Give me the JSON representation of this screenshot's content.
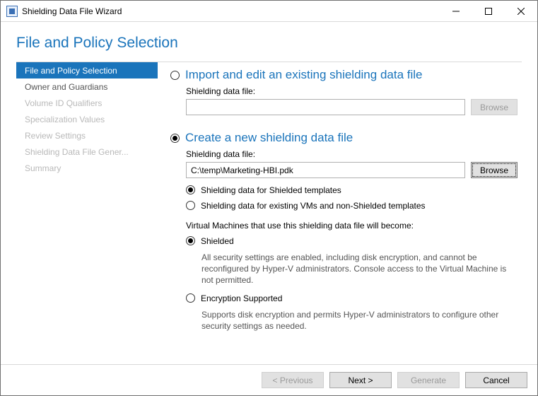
{
  "window": {
    "title": "Shielding Data File Wizard"
  },
  "heading": "File and Policy Selection",
  "sidebar": {
    "items": [
      {
        "label": "File and Policy Selection",
        "active": true,
        "enabled": true
      },
      {
        "label": "Owner and Guardians",
        "active": false,
        "enabled": true
      },
      {
        "label": "Volume ID Qualifiers",
        "active": false,
        "enabled": false
      },
      {
        "label": "Specialization Values",
        "active": false,
        "enabled": false
      },
      {
        "label": "Review Settings",
        "active": false,
        "enabled": false
      },
      {
        "label": "Shielding Data File Gener...",
        "active": false,
        "enabled": false
      },
      {
        "label": "Summary",
        "active": false,
        "enabled": false
      }
    ]
  },
  "main": {
    "option_import": {
      "label": "Import and edit an existing shielding data file",
      "field_label": "Shielding data file:",
      "value": "",
      "browse": "Browse"
    },
    "option_create": {
      "label": "Create a new shielding data file",
      "field_label": "Shielding data file:",
      "value": "C:\\temp\\Marketing-HBI.pdk",
      "browse": "Browse",
      "template_options": {
        "shielded": "Shielding data for Shielded templates",
        "nonshielded": "Shielding data for existing VMs and non-Shielded templates"
      },
      "vm_intro": "Virtual Machines that use this shielding data file will become:",
      "vm_options": {
        "shielded_label": "Shielded",
        "shielded_desc": "All security settings are enabled, including disk encryption, and cannot be reconfigured by Hyper-V administrators. Console access to the Virtual Machine is not permitted.",
        "enc_label": "Encryption Supported",
        "enc_desc": "Supports disk encryption and permits Hyper-V administrators to configure other security settings as needed."
      }
    }
  },
  "footer": {
    "previous": "< Previous",
    "next": "Next >",
    "generate": "Generate",
    "cancel": "Cancel"
  }
}
